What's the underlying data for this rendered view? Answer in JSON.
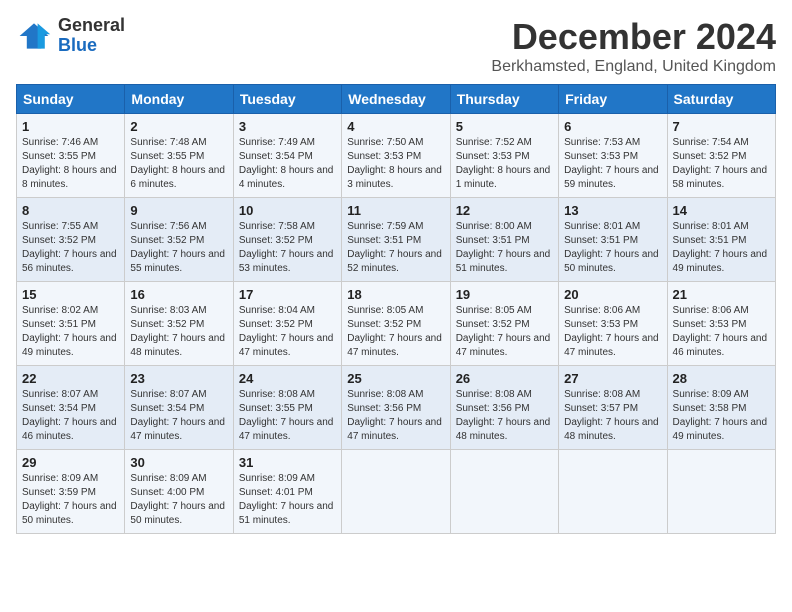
{
  "logo": {
    "text_general": "General",
    "text_blue": "Blue"
  },
  "header": {
    "month": "December 2024",
    "location": "Berkhamsted, England, United Kingdom"
  },
  "days_of_week": [
    "Sunday",
    "Monday",
    "Tuesday",
    "Wednesday",
    "Thursday",
    "Friday",
    "Saturday"
  ],
  "weeks": [
    [
      {
        "day": "1",
        "sunrise": "Sunrise: 7:46 AM",
        "sunset": "Sunset: 3:55 PM",
        "daylight": "Daylight: 8 hours and 8 minutes."
      },
      {
        "day": "2",
        "sunrise": "Sunrise: 7:48 AM",
        "sunset": "Sunset: 3:55 PM",
        "daylight": "Daylight: 8 hours and 6 minutes."
      },
      {
        "day": "3",
        "sunrise": "Sunrise: 7:49 AM",
        "sunset": "Sunset: 3:54 PM",
        "daylight": "Daylight: 8 hours and 4 minutes."
      },
      {
        "day": "4",
        "sunrise": "Sunrise: 7:50 AM",
        "sunset": "Sunset: 3:53 PM",
        "daylight": "Daylight: 8 hours and 3 minutes."
      },
      {
        "day": "5",
        "sunrise": "Sunrise: 7:52 AM",
        "sunset": "Sunset: 3:53 PM",
        "daylight": "Daylight: 8 hours and 1 minute."
      },
      {
        "day": "6",
        "sunrise": "Sunrise: 7:53 AM",
        "sunset": "Sunset: 3:53 PM",
        "daylight": "Daylight: 7 hours and 59 minutes."
      },
      {
        "day": "7",
        "sunrise": "Sunrise: 7:54 AM",
        "sunset": "Sunset: 3:52 PM",
        "daylight": "Daylight: 7 hours and 58 minutes."
      }
    ],
    [
      {
        "day": "8",
        "sunrise": "Sunrise: 7:55 AM",
        "sunset": "Sunset: 3:52 PM",
        "daylight": "Daylight: 7 hours and 56 minutes."
      },
      {
        "day": "9",
        "sunrise": "Sunrise: 7:56 AM",
        "sunset": "Sunset: 3:52 PM",
        "daylight": "Daylight: 7 hours and 55 minutes."
      },
      {
        "day": "10",
        "sunrise": "Sunrise: 7:58 AM",
        "sunset": "Sunset: 3:52 PM",
        "daylight": "Daylight: 7 hours and 53 minutes."
      },
      {
        "day": "11",
        "sunrise": "Sunrise: 7:59 AM",
        "sunset": "Sunset: 3:51 PM",
        "daylight": "Daylight: 7 hours and 52 minutes."
      },
      {
        "day": "12",
        "sunrise": "Sunrise: 8:00 AM",
        "sunset": "Sunset: 3:51 PM",
        "daylight": "Daylight: 7 hours and 51 minutes."
      },
      {
        "day": "13",
        "sunrise": "Sunrise: 8:01 AM",
        "sunset": "Sunset: 3:51 PM",
        "daylight": "Daylight: 7 hours and 50 minutes."
      },
      {
        "day": "14",
        "sunrise": "Sunrise: 8:01 AM",
        "sunset": "Sunset: 3:51 PM",
        "daylight": "Daylight: 7 hours and 49 minutes."
      }
    ],
    [
      {
        "day": "15",
        "sunrise": "Sunrise: 8:02 AM",
        "sunset": "Sunset: 3:51 PM",
        "daylight": "Daylight: 7 hours and 49 minutes."
      },
      {
        "day": "16",
        "sunrise": "Sunrise: 8:03 AM",
        "sunset": "Sunset: 3:52 PM",
        "daylight": "Daylight: 7 hours and 48 minutes."
      },
      {
        "day": "17",
        "sunrise": "Sunrise: 8:04 AM",
        "sunset": "Sunset: 3:52 PM",
        "daylight": "Daylight: 7 hours and 47 minutes."
      },
      {
        "day": "18",
        "sunrise": "Sunrise: 8:05 AM",
        "sunset": "Sunset: 3:52 PM",
        "daylight": "Daylight: 7 hours and 47 minutes."
      },
      {
        "day": "19",
        "sunrise": "Sunrise: 8:05 AM",
        "sunset": "Sunset: 3:52 PM",
        "daylight": "Daylight: 7 hours and 47 minutes."
      },
      {
        "day": "20",
        "sunrise": "Sunrise: 8:06 AM",
        "sunset": "Sunset: 3:53 PM",
        "daylight": "Daylight: 7 hours and 47 minutes."
      },
      {
        "day": "21",
        "sunrise": "Sunrise: 8:06 AM",
        "sunset": "Sunset: 3:53 PM",
        "daylight": "Daylight: 7 hours and 46 minutes."
      }
    ],
    [
      {
        "day": "22",
        "sunrise": "Sunrise: 8:07 AM",
        "sunset": "Sunset: 3:54 PM",
        "daylight": "Daylight: 7 hours and 46 minutes."
      },
      {
        "day": "23",
        "sunrise": "Sunrise: 8:07 AM",
        "sunset": "Sunset: 3:54 PM",
        "daylight": "Daylight: 7 hours and 47 minutes."
      },
      {
        "day": "24",
        "sunrise": "Sunrise: 8:08 AM",
        "sunset": "Sunset: 3:55 PM",
        "daylight": "Daylight: 7 hours and 47 minutes."
      },
      {
        "day": "25",
        "sunrise": "Sunrise: 8:08 AM",
        "sunset": "Sunset: 3:56 PM",
        "daylight": "Daylight: 7 hours and 47 minutes."
      },
      {
        "day": "26",
        "sunrise": "Sunrise: 8:08 AM",
        "sunset": "Sunset: 3:56 PM",
        "daylight": "Daylight: 7 hours and 48 minutes."
      },
      {
        "day": "27",
        "sunrise": "Sunrise: 8:08 AM",
        "sunset": "Sunset: 3:57 PM",
        "daylight": "Daylight: 7 hours and 48 minutes."
      },
      {
        "day": "28",
        "sunrise": "Sunrise: 8:09 AM",
        "sunset": "Sunset: 3:58 PM",
        "daylight": "Daylight: 7 hours and 49 minutes."
      }
    ],
    [
      {
        "day": "29",
        "sunrise": "Sunrise: 8:09 AM",
        "sunset": "Sunset: 3:59 PM",
        "daylight": "Daylight: 7 hours and 50 minutes."
      },
      {
        "day": "30",
        "sunrise": "Sunrise: 8:09 AM",
        "sunset": "Sunset: 4:00 PM",
        "daylight": "Daylight: 7 hours and 50 minutes."
      },
      {
        "day": "31",
        "sunrise": "Sunrise: 8:09 AM",
        "sunset": "Sunset: 4:01 PM",
        "daylight": "Daylight: 7 hours and 51 minutes."
      },
      null,
      null,
      null,
      null
    ]
  ]
}
